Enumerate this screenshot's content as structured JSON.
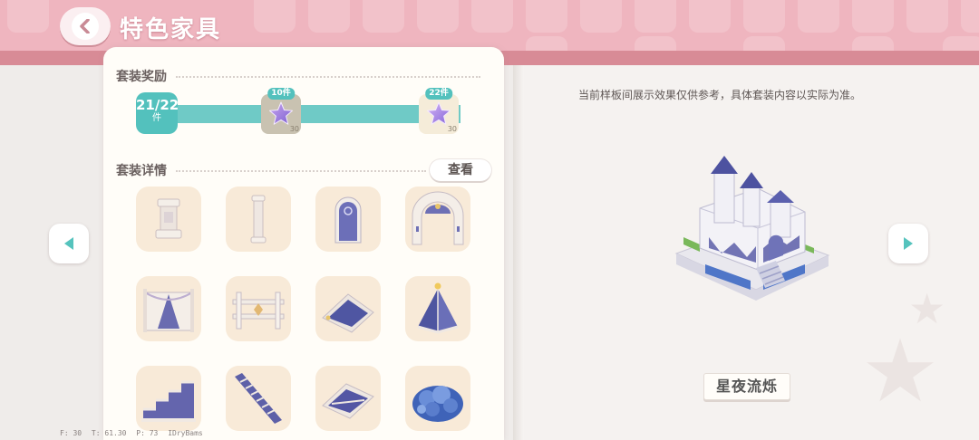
{
  "header": {
    "title": "特色家具",
    "accent": "#efb5bf"
  },
  "set_reward": {
    "title": "套装奖励",
    "count": "21/22",
    "count_unit": "件",
    "progress": 0.95,
    "rewards": [
      {
        "tag": "10件",
        "amount": "30",
        "icon": "purple-star-icon",
        "claimed": true
      },
      {
        "tag": "22件",
        "amount": "30",
        "icon": "purple-star-icon",
        "claimed": false
      }
    ]
  },
  "set_details": {
    "title": "套装详情",
    "view_label": "查看",
    "items": [
      {
        "icon": "pedestal-icon"
      },
      {
        "icon": "pillar-icon"
      },
      {
        "icon": "arched-door-icon"
      },
      {
        "icon": "archway-gate-icon"
      },
      {
        "icon": "curtain-wall-icon"
      },
      {
        "icon": "fence-icon"
      },
      {
        "icon": "sloped-roof-icon"
      },
      {
        "icon": "pyramid-roof-icon"
      },
      {
        "icon": "stairs-icon"
      },
      {
        "icon": "ladder-stairs-icon"
      },
      {
        "icon": "roof-sheet-icon"
      },
      {
        "icon": "blue-hydrangea-bush-icon"
      }
    ]
  },
  "preview": {
    "notice": "当前样板间展示效果仅供参考，具体套装内容以实际为准。",
    "set_name": "星夜流烁",
    "icon": "castle-model-icon"
  },
  "debug": {
    "items": [
      "F: 30",
      "T: 61.30",
      "P: 73",
      "IDryBams"
    ]
  },
  "colors": {
    "teal": "#53c1bd",
    "panel": "#fffdf8",
    "item_bg": "#f8ead8"
  }
}
